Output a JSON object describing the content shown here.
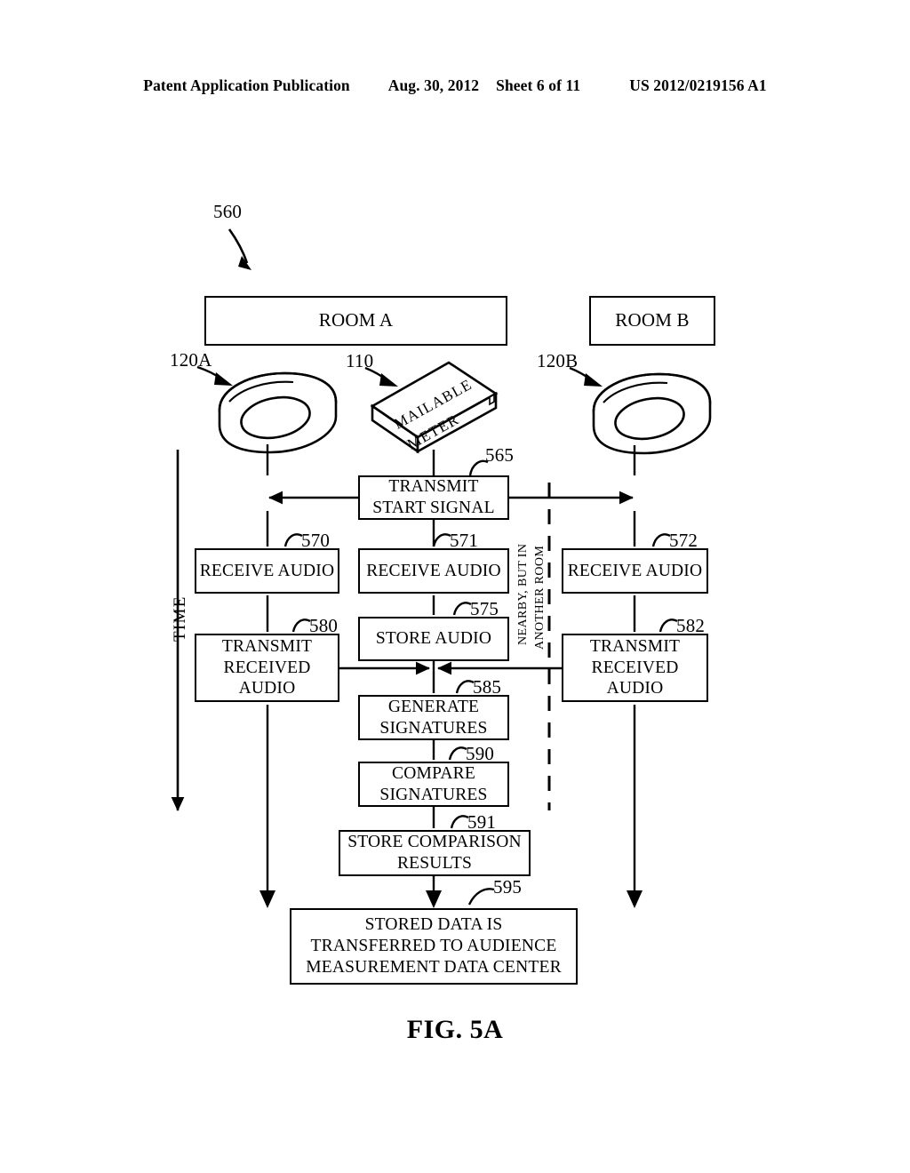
{
  "page_header": {
    "publication": "Patent Application Publication",
    "date": "Aug. 30, 2012",
    "sheet": "Sheet 6 of 11",
    "pub_number": "US 2012/0219156 A1"
  },
  "figure": {
    "caption": "FIG. 5A",
    "diagram_ref": "560",
    "rooms": [
      {
        "ref": "",
        "label": "ROOM A"
      },
      {
        "ref": "",
        "label": "ROOM B"
      }
    ],
    "devices": [
      {
        "ref": "120A",
        "name": "wristband-device-a",
        "label": ""
      },
      {
        "ref": "110",
        "name": "mailable-meter",
        "label_line1": "MAILABLE",
        "label_line2": "METER"
      },
      {
        "ref": "120B",
        "name": "wristband-device-b",
        "label": ""
      }
    ],
    "axis_label": "TIME",
    "divider_label_line1": "NEARBY, BUT IN",
    "divider_label_line2": "ANOTHER ROOM",
    "steps": [
      {
        "ref": "565",
        "label_line1": "TRANSMIT",
        "label_line2": "START SIGNAL",
        "label": "TRANSMIT START SIGNAL"
      },
      {
        "ref": "570",
        "label": "RECEIVE AUDIO"
      },
      {
        "ref": "571",
        "label": "RECEIVE AUDIO"
      },
      {
        "ref": "572",
        "label": "RECEIVE AUDIO"
      },
      {
        "ref": "575",
        "label": "STORE AUDIO"
      },
      {
        "ref": "580",
        "label_line1": "TRANSMIT",
        "label_line2": "RECEIVED",
        "label_line3": "AUDIO"
      },
      {
        "ref": "582",
        "label_line1": "TRANSMIT",
        "label_line2": "RECEIVED",
        "label_line3": "AUDIO"
      },
      {
        "ref": "585",
        "label_line1": "GENERATE",
        "label_line2": "SIGNATURES"
      },
      {
        "ref": "590",
        "label_line1": "COMPARE",
        "label_line2": "SIGNATURES"
      },
      {
        "ref": "591",
        "label_line1": "STORE COMPARISON",
        "label_line2": "RESULTS"
      },
      {
        "ref": "595",
        "label_line1": "STORED DATA IS",
        "label_line2": "TRANSFERRED TO AUDIENCE",
        "label_line3": "MEASUREMENT DATA CENTER"
      }
    ],
    "colors": {
      "ink": "#000000",
      "paper": "#ffffff"
    }
  }
}
